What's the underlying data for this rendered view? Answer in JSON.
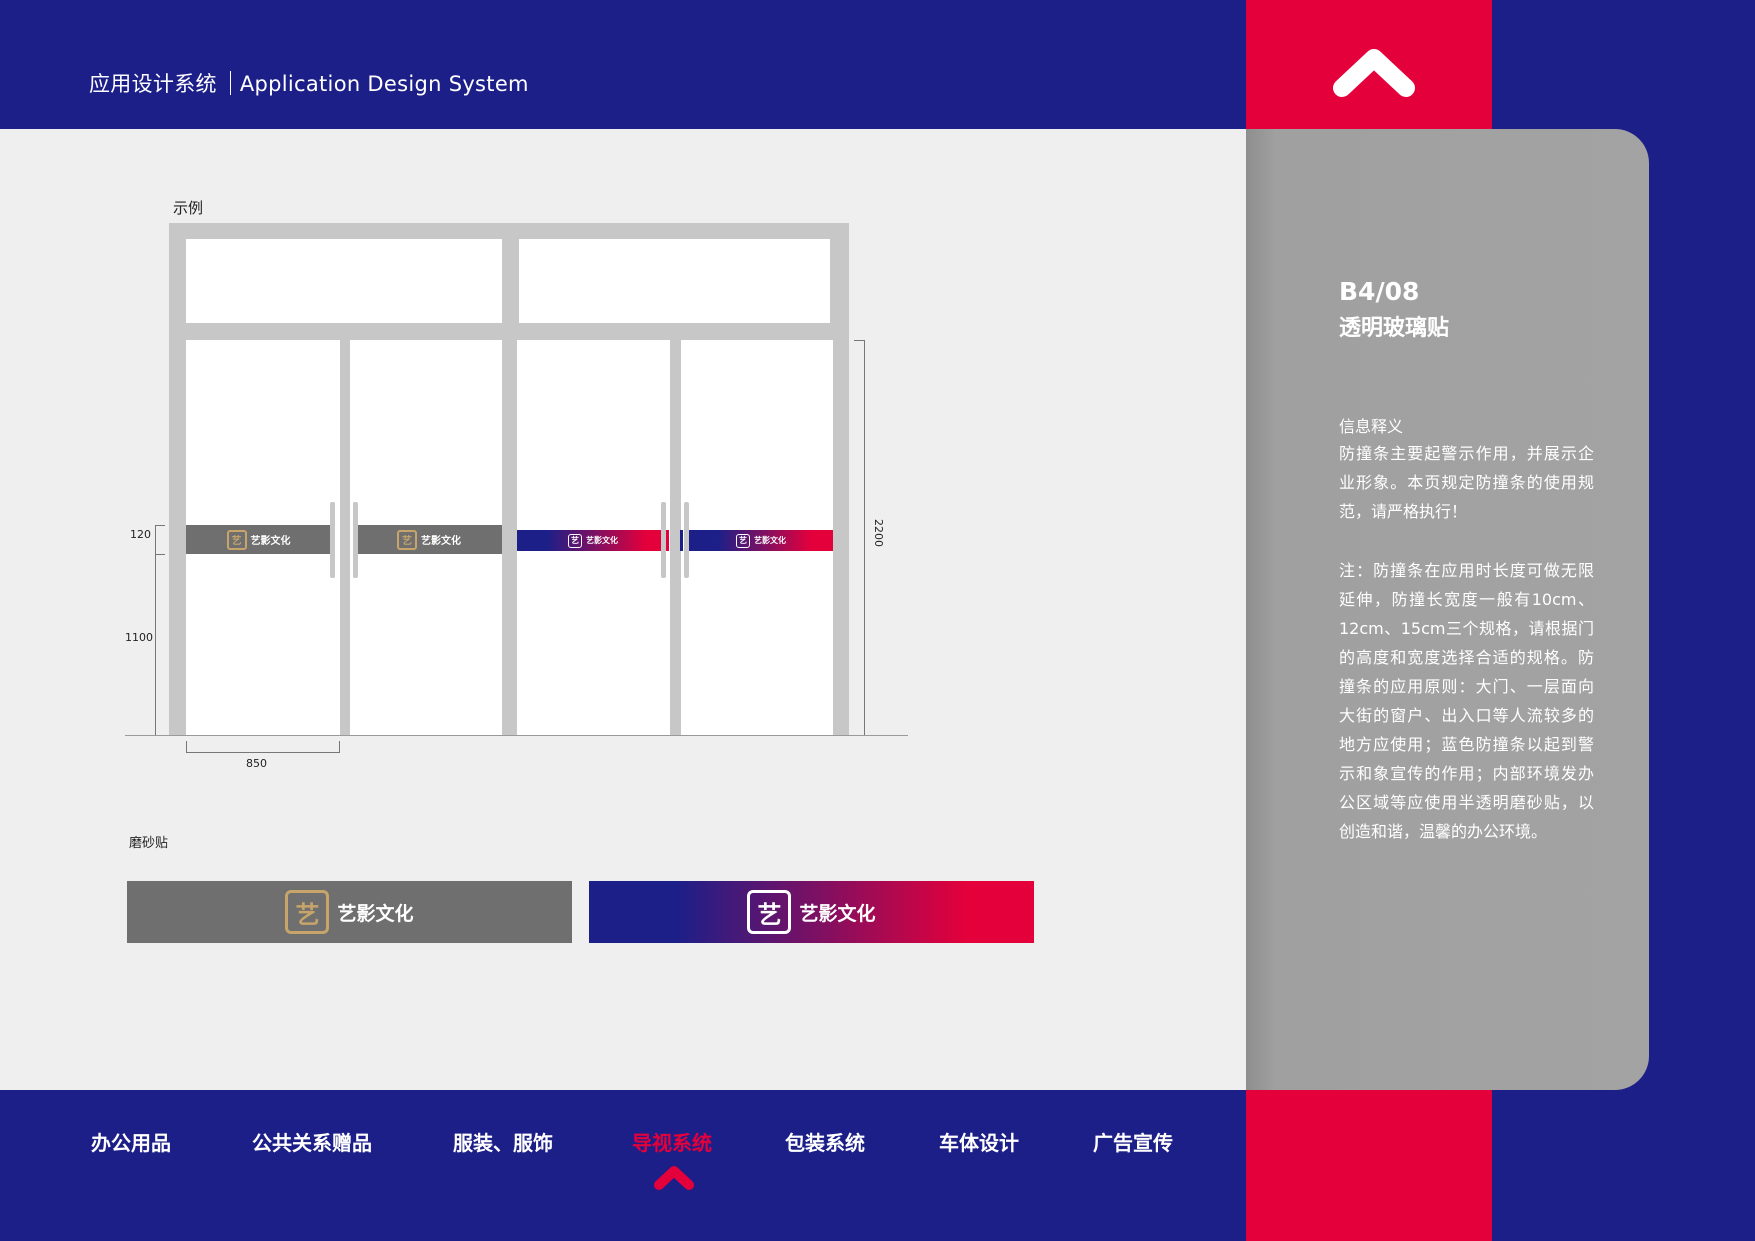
{
  "header": {
    "title_cn": "应用设计系统",
    "title_en": "Application Design System"
  },
  "side_panel": {
    "page_code": "B4/08",
    "page_title": "透明玻璃贴",
    "info_heading": "信息释义",
    "info_body": "防撞条主要起警示作用，并展示企业形象。本页规定防撞条的使用规范，请严格执行！",
    "note_body": "注：防撞条在应用时长度可做无限延伸，防撞长宽度一般有10cm、12cm、15cm三个规格，请根据门的高度和宽度选择合适的规格。防撞条的应用原则：大门、一层面向大街的窗户、出入口等人流较多的地方应使用；蓝色防撞条以起到警示和象宣传的作用；内部环境发办公区域等应使用半透明磨砂贴，以创造和谐，温馨的办公环境。"
  },
  "diagram": {
    "example_label": "示例",
    "frosted_label": "磨砂贴",
    "dim_strip_height": "120",
    "dim_strip_from_floor": "1100",
    "dim_door_height": "2200",
    "dim_door_width": "850",
    "brand_name": "艺影文化",
    "logo_glyph": "艺"
  },
  "nav": {
    "items": [
      {
        "label": "办公用品"
      },
      {
        "label": "公共关系赠品"
      },
      {
        "label": "服装、服饰"
      },
      {
        "label": "导视系统"
      },
      {
        "label": "包装系统"
      },
      {
        "label": "车体设计"
      },
      {
        "label": "广告宣传"
      }
    ],
    "active_index": 3
  },
  "colors": {
    "brand_blue": "#1d1f88",
    "brand_red": "#e4003b",
    "panel_grey": "#a3a3a3",
    "strip_grey": "#6f6f6f",
    "logo_gold": "#c6a46a"
  },
  "icons": {
    "top_right": "chevron-up-icon",
    "nav_active_marker": "chevron-up-icon"
  }
}
